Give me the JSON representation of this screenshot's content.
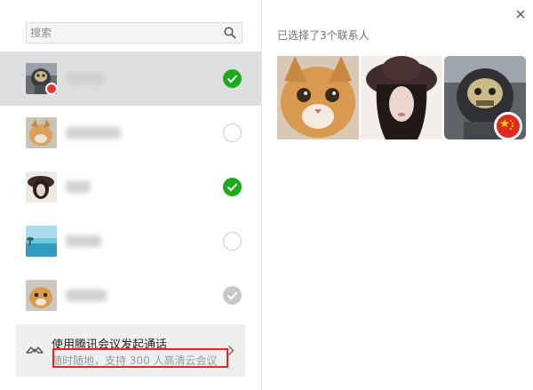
{
  "search": {
    "placeholder": "搜索"
  },
  "contacts": [
    {
      "avatar": "robot-avatar",
      "state": "checked"
    },
    {
      "avatar": "cat-avatar",
      "state": "unchecked"
    },
    {
      "avatar": "girl-hat-avatar",
      "state": "checked"
    },
    {
      "avatar": "landscape-avatar",
      "state": "unchecked"
    },
    {
      "avatar": "cat-avatar",
      "state": "disabled"
    }
  ],
  "meeting": {
    "title": "使用腾讯会议发起通话",
    "subtitle": "随时随地，支持 300 人高清云会议"
  },
  "right": {
    "selected_count": "已选择了3个联系人"
  },
  "colors": {
    "check_green": "#1aad19",
    "selected_row_bg": "#dedfe1",
    "highlight_red": "#e02a2a"
  }
}
